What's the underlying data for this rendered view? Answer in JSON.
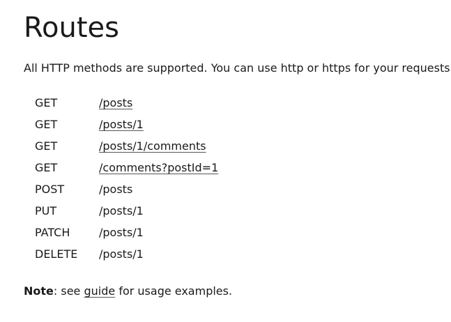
{
  "title": "Routes",
  "intro": "All HTTP methods are supported. You can use http or https for your requests.",
  "routes": [
    {
      "method": "GET",
      "path": "/posts",
      "link": true
    },
    {
      "method": "GET",
      "path": "/posts/1",
      "link": true
    },
    {
      "method": "GET",
      "path": "/posts/1/comments",
      "link": true
    },
    {
      "method": "GET",
      "path": "/comments?postId=1",
      "link": true
    },
    {
      "method": "POST",
      "path": "/posts",
      "link": false
    },
    {
      "method": "PUT",
      "path": "/posts/1",
      "link": false
    },
    {
      "method": "PATCH",
      "path": "/posts/1",
      "link": false
    },
    {
      "method": "DELETE",
      "path": "/posts/1",
      "link": false
    }
  ],
  "note": {
    "label": "Note",
    "before": ": see ",
    "link_text": "guide",
    "after": " for usage examples."
  }
}
